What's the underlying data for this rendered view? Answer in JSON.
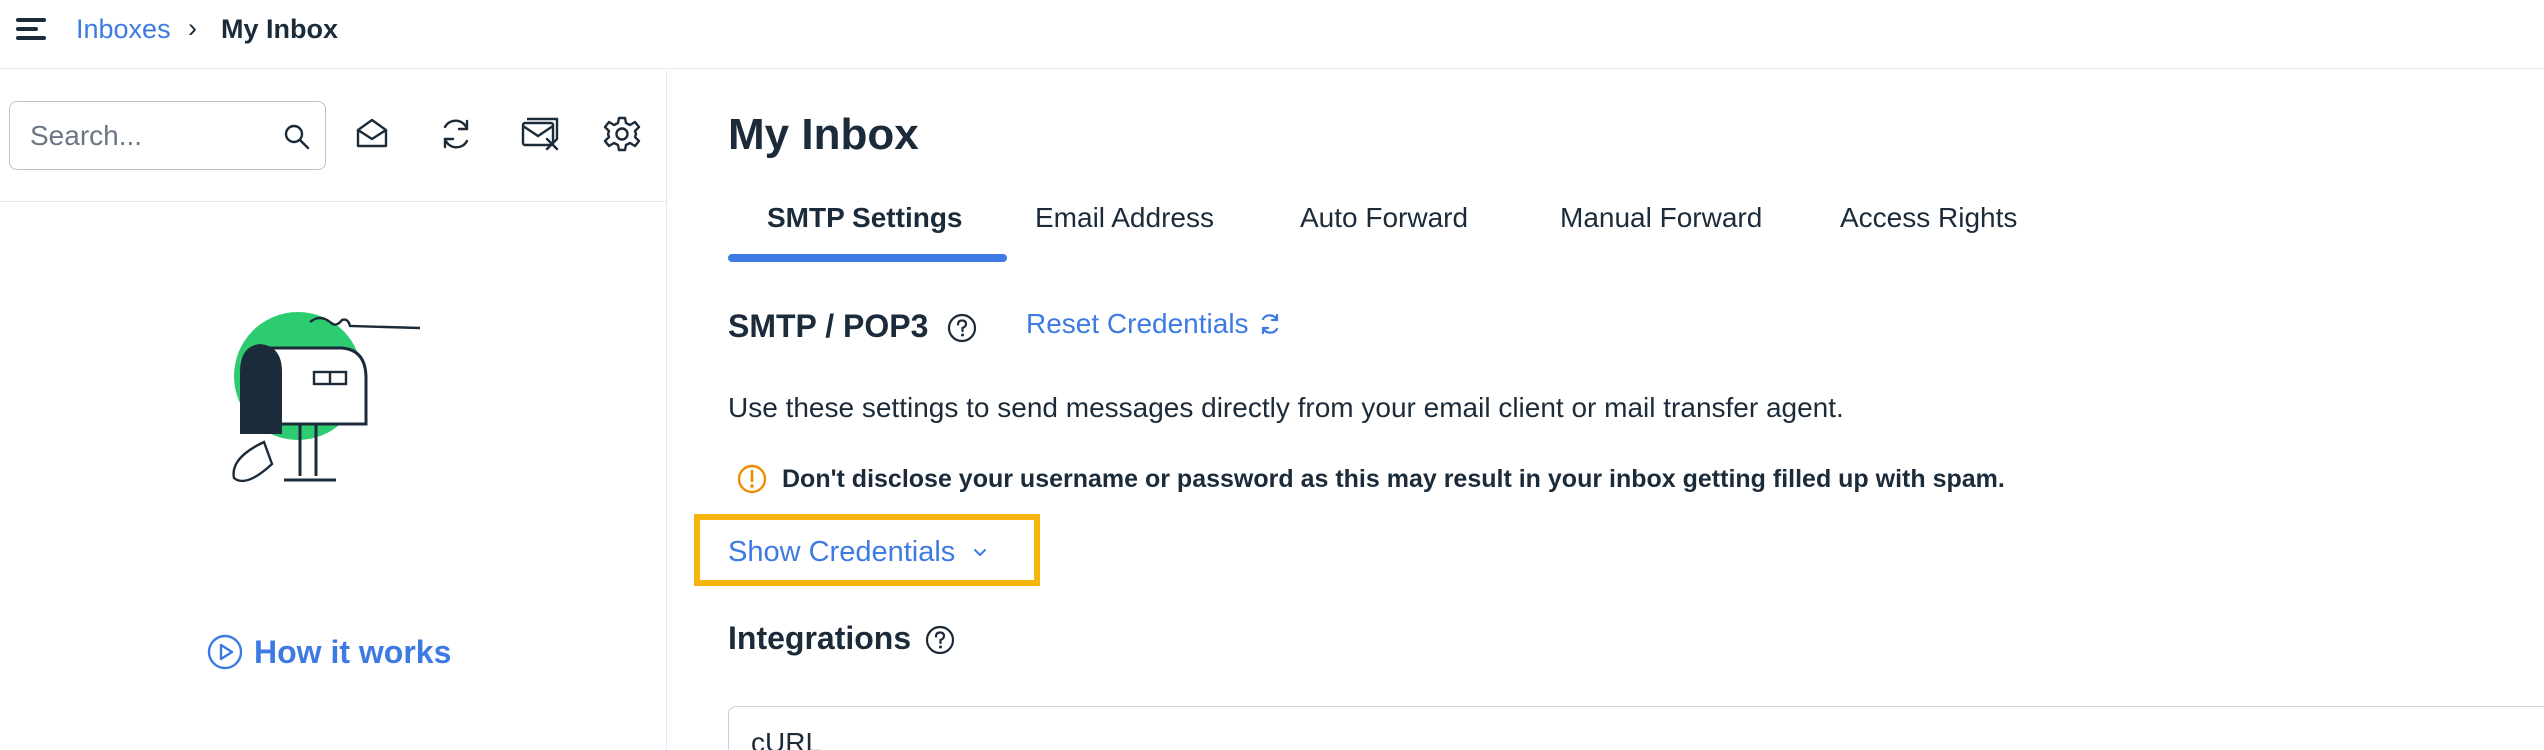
{
  "header": {
    "breadcrumb_link": "Inboxes",
    "breadcrumb_separator": "›",
    "breadcrumb_current": "My Inbox"
  },
  "sidebar": {
    "search": {
      "placeholder": "Search...",
      "value": ""
    },
    "toolbar_icons": [
      "mark-read-icon",
      "refresh-icon",
      "clear-inbox-icon",
      "settings-gear-icon"
    ],
    "how_it_works": "How it works"
  },
  "main": {
    "title": "My Inbox",
    "tabs": [
      {
        "label": "SMTP Settings",
        "active": true
      },
      {
        "label": "Email Address",
        "active": false
      },
      {
        "label": "Auto Forward",
        "active": false
      },
      {
        "label": "Manual Forward",
        "active": false
      },
      {
        "label": "Access Rights",
        "active": false
      }
    ],
    "smtp_section": {
      "title": "SMTP / POP3",
      "reset_label": "Reset Credentials",
      "description": "Use these settings to send messages directly from your email client or mail transfer agent.",
      "warning": "Don't disclose your username or password as this may result in your inbox getting filled up with spam.",
      "show_credentials": "Show Credentials"
    },
    "integrations": {
      "title": "Integrations",
      "selected": "cURL"
    }
  },
  "colors": {
    "accent": "#3d7ae3",
    "text": "#1c2b3a",
    "highlight": "#f5b50a",
    "warning": "#f08c00",
    "illustration_green": "#2ecc71"
  }
}
